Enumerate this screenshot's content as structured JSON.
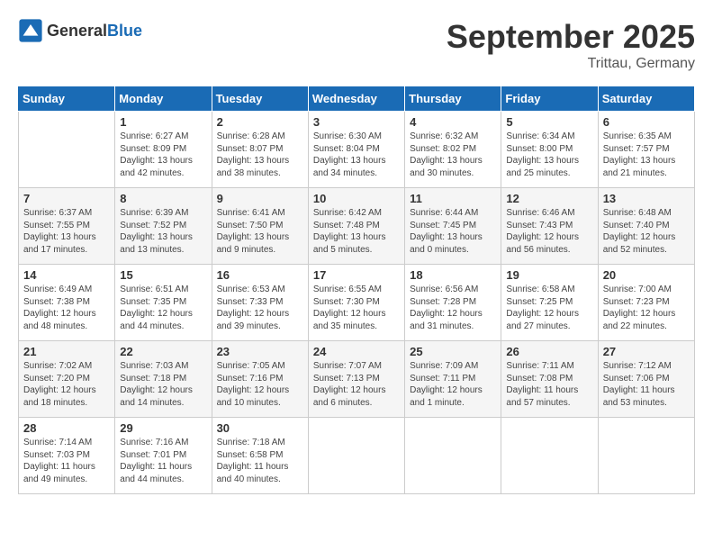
{
  "header": {
    "logo_general": "General",
    "logo_blue": "Blue",
    "month_title": "September 2025",
    "location": "Trittau, Germany"
  },
  "columns": [
    "Sunday",
    "Monday",
    "Tuesday",
    "Wednesday",
    "Thursday",
    "Friday",
    "Saturday"
  ],
  "weeks": [
    [
      {
        "day": "",
        "empty": true
      },
      {
        "day": "1",
        "sunrise": "6:27 AM",
        "sunset": "8:09 PM",
        "daylight": "13 hours and 42 minutes."
      },
      {
        "day": "2",
        "sunrise": "6:28 AM",
        "sunset": "8:07 PM",
        "daylight": "13 hours and 38 minutes."
      },
      {
        "day": "3",
        "sunrise": "6:30 AM",
        "sunset": "8:04 PM",
        "daylight": "13 hours and 34 minutes."
      },
      {
        "day": "4",
        "sunrise": "6:32 AM",
        "sunset": "8:02 PM",
        "daylight": "13 hours and 30 minutes."
      },
      {
        "day": "5",
        "sunrise": "6:34 AM",
        "sunset": "8:00 PM",
        "daylight": "13 hours and 25 minutes."
      },
      {
        "day": "6",
        "sunrise": "6:35 AM",
        "sunset": "7:57 PM",
        "daylight": "13 hours and 21 minutes."
      }
    ],
    [
      {
        "day": "7",
        "sunrise": "6:37 AM",
        "sunset": "7:55 PM",
        "daylight": "13 hours and 17 minutes."
      },
      {
        "day": "8",
        "sunrise": "6:39 AM",
        "sunset": "7:52 PM",
        "daylight": "13 hours and 13 minutes."
      },
      {
        "day": "9",
        "sunrise": "6:41 AM",
        "sunset": "7:50 PM",
        "daylight": "13 hours and 9 minutes."
      },
      {
        "day": "10",
        "sunrise": "6:42 AM",
        "sunset": "7:48 PM",
        "daylight": "13 hours and 5 minutes."
      },
      {
        "day": "11",
        "sunrise": "6:44 AM",
        "sunset": "7:45 PM",
        "daylight": "13 hours and 0 minutes."
      },
      {
        "day": "12",
        "sunrise": "6:46 AM",
        "sunset": "7:43 PM",
        "daylight": "12 hours and 56 minutes."
      },
      {
        "day": "13",
        "sunrise": "6:48 AM",
        "sunset": "7:40 PM",
        "daylight": "12 hours and 52 minutes."
      }
    ],
    [
      {
        "day": "14",
        "sunrise": "6:49 AM",
        "sunset": "7:38 PM",
        "daylight": "12 hours and 48 minutes."
      },
      {
        "day": "15",
        "sunrise": "6:51 AM",
        "sunset": "7:35 PM",
        "daylight": "12 hours and 44 minutes."
      },
      {
        "day": "16",
        "sunrise": "6:53 AM",
        "sunset": "7:33 PM",
        "daylight": "12 hours and 39 minutes."
      },
      {
        "day": "17",
        "sunrise": "6:55 AM",
        "sunset": "7:30 PM",
        "daylight": "12 hours and 35 minutes."
      },
      {
        "day": "18",
        "sunrise": "6:56 AM",
        "sunset": "7:28 PM",
        "daylight": "12 hours and 31 minutes."
      },
      {
        "day": "19",
        "sunrise": "6:58 AM",
        "sunset": "7:25 PM",
        "daylight": "12 hours and 27 minutes."
      },
      {
        "day": "20",
        "sunrise": "7:00 AM",
        "sunset": "7:23 PM",
        "daylight": "12 hours and 22 minutes."
      }
    ],
    [
      {
        "day": "21",
        "sunrise": "7:02 AM",
        "sunset": "7:20 PM",
        "daylight": "12 hours and 18 minutes."
      },
      {
        "day": "22",
        "sunrise": "7:03 AM",
        "sunset": "7:18 PM",
        "daylight": "12 hours and 14 minutes."
      },
      {
        "day": "23",
        "sunrise": "7:05 AM",
        "sunset": "7:16 PM",
        "daylight": "12 hours and 10 minutes."
      },
      {
        "day": "24",
        "sunrise": "7:07 AM",
        "sunset": "7:13 PM",
        "daylight": "12 hours and 6 minutes."
      },
      {
        "day": "25",
        "sunrise": "7:09 AM",
        "sunset": "7:11 PM",
        "daylight": "12 hours and 1 minute."
      },
      {
        "day": "26",
        "sunrise": "7:11 AM",
        "sunset": "7:08 PM",
        "daylight": "11 hours and 57 minutes."
      },
      {
        "day": "27",
        "sunrise": "7:12 AM",
        "sunset": "7:06 PM",
        "daylight": "11 hours and 53 minutes."
      }
    ],
    [
      {
        "day": "28",
        "sunrise": "7:14 AM",
        "sunset": "7:03 PM",
        "daylight": "11 hours and 49 minutes."
      },
      {
        "day": "29",
        "sunrise": "7:16 AM",
        "sunset": "7:01 PM",
        "daylight": "11 hours and 44 minutes."
      },
      {
        "day": "30",
        "sunrise": "7:18 AM",
        "sunset": "6:58 PM",
        "daylight": "11 hours and 40 minutes."
      },
      {
        "day": "",
        "empty": true
      },
      {
        "day": "",
        "empty": true
      },
      {
        "day": "",
        "empty": true
      },
      {
        "day": "",
        "empty": true
      }
    ]
  ]
}
